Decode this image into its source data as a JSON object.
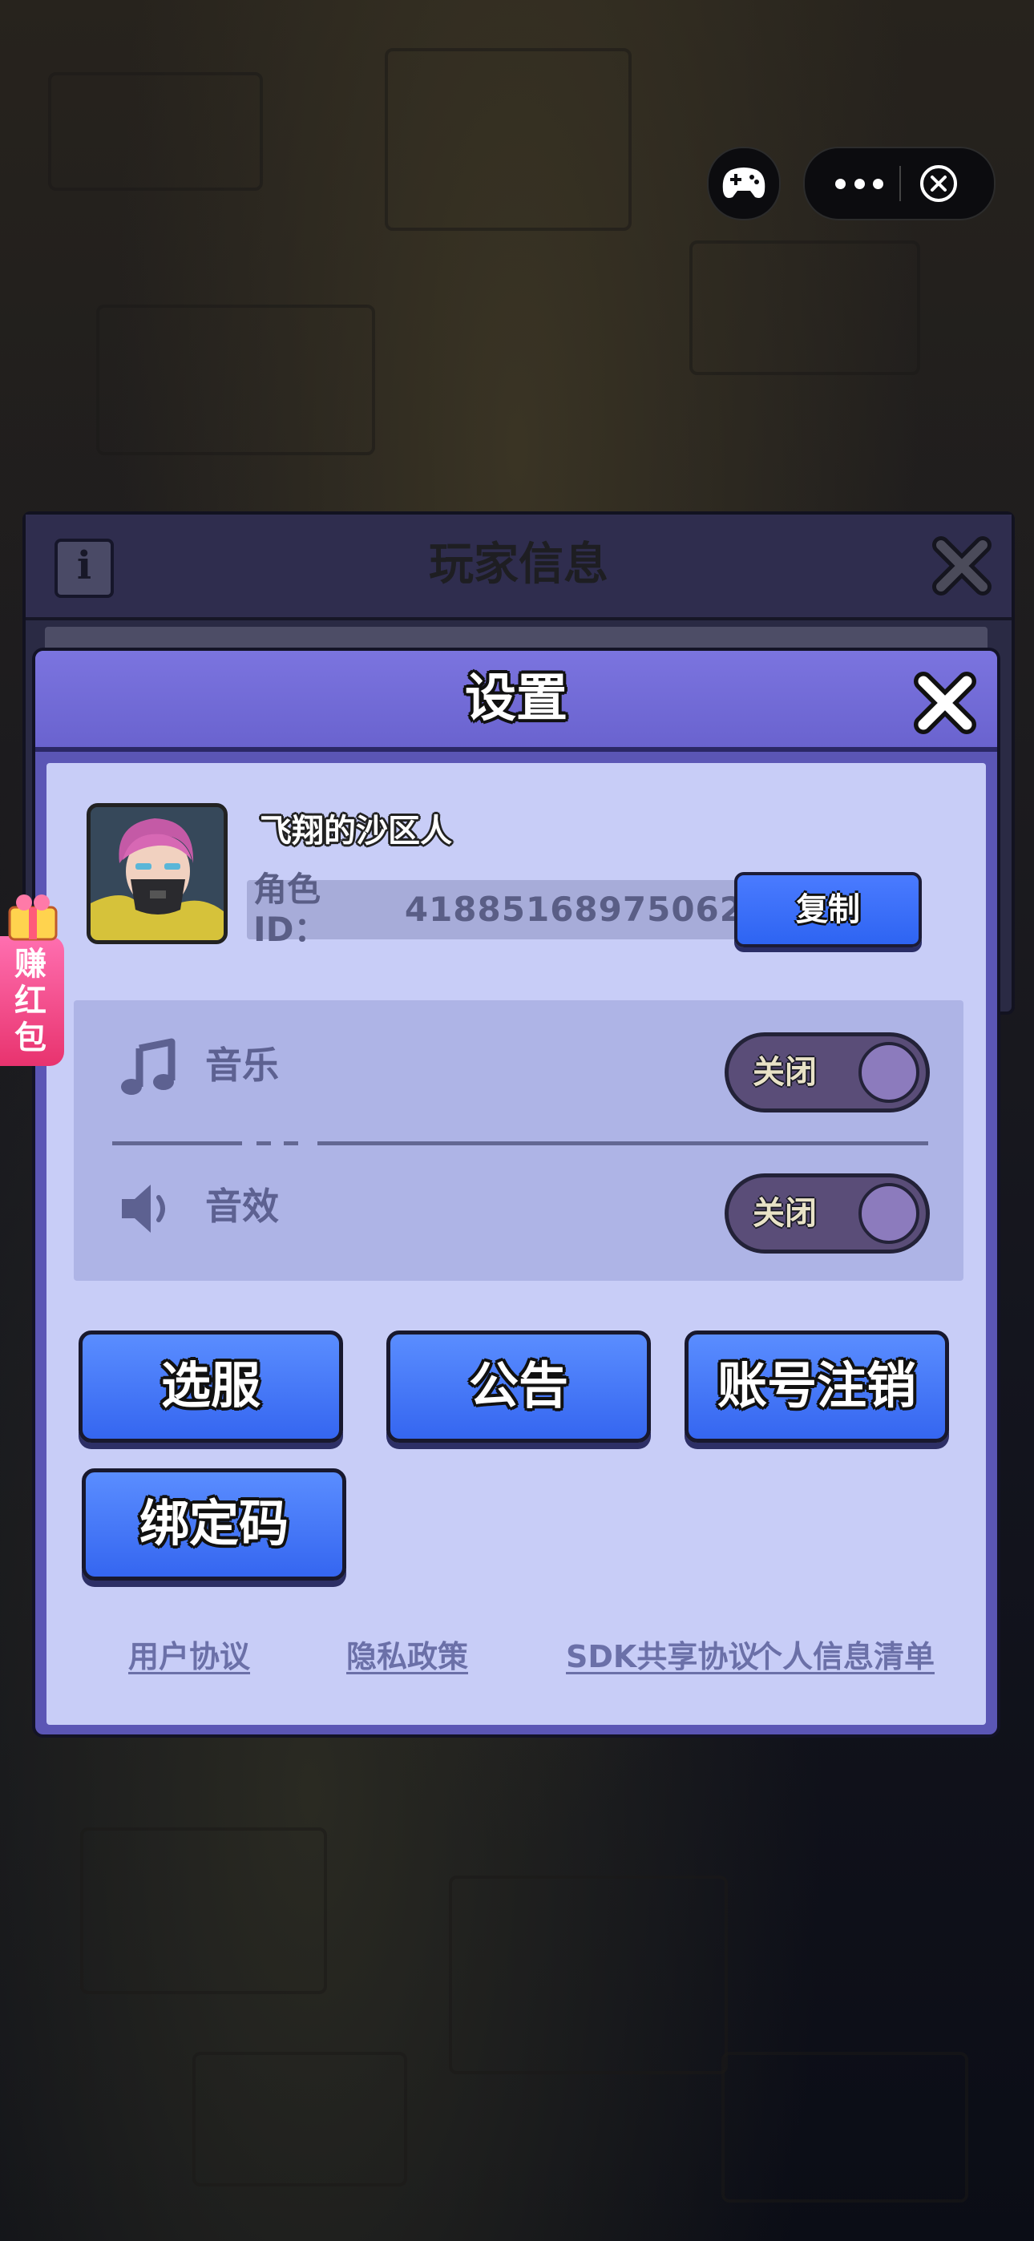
{
  "background_dialog": {
    "title": "玩家信息",
    "info_icon_glyph": "i"
  },
  "settings": {
    "title": "设置",
    "profile": {
      "username": "飞翔的沙区人",
      "role_id_label": "角色ID：",
      "role_id_value": "41885168975062",
      "copy_button_label": "复制"
    },
    "sound": {
      "music_label": "音乐",
      "music_toggle_label": "关闭",
      "music_enabled": false,
      "sfx_label": "音效",
      "sfx_toggle_label": "关闭",
      "sfx_enabled": false
    },
    "actions": {
      "select_server": "选服",
      "announcement": "公告",
      "account_cancel": "账号注销",
      "binding_code": "绑定码"
    },
    "links": {
      "user_agreement": "用户协议",
      "privacy_policy": "隐私政策",
      "sdk_agreement": "SDK共享协议",
      "personal_info_list": "个人信息清单"
    }
  },
  "side_float": {
    "label": "赚红包"
  },
  "icons": {
    "capsule_game": "gamepad-icon",
    "capsule_more": "more-dots-icon",
    "capsule_close": "close-circle-icon",
    "dialog_close": "close-x-icon",
    "music": "music-note-icon",
    "sfx": "speaker-icon"
  },
  "colors": {
    "dialog_header": "#6a63cf",
    "panel": "#c8cdf7",
    "button_blue": "#3566f0",
    "toggle_off": "#5a4d78"
  }
}
